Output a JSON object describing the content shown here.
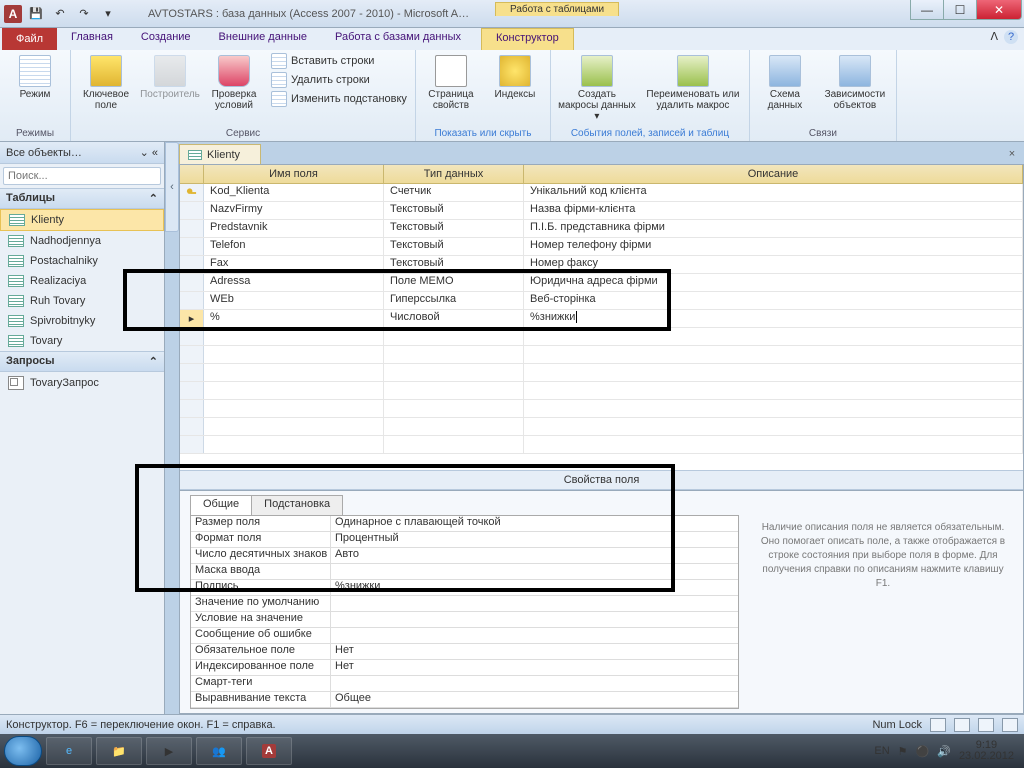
{
  "title": "AVTOSTARS : база данных (Access 2007 - 2010) -  Microsoft A…",
  "context_tab_group": "Работа с таблицами",
  "file_tab": "Файл",
  "tabs": [
    "Главная",
    "Создание",
    "Внешние данные",
    "Работа с базами данных"
  ],
  "context_tab": "Конструктор",
  "ribbon": {
    "g1": {
      "mode": "Режим",
      "label": "Режимы"
    },
    "g2": {
      "key": "Ключевое поле",
      "builder": "Построитель",
      "check": "Проверка условий",
      "insert": "Вставить строки",
      "delete": "Удалить строки",
      "modify": "Изменить подстановку",
      "label": "Сервис"
    },
    "g3": {
      "prop": "Страница свойств",
      "index": "Индексы",
      "label": "Показать или скрыть"
    },
    "g4": {
      "createmacro": "Создать макросы данных ▾",
      "rename": "Переименовать или удалить макрос",
      "label": "События полей, записей и таблиц"
    },
    "g5": {
      "schema": "Схема данных",
      "deps": "Зависимости объектов",
      "label": "Связи"
    }
  },
  "nav": {
    "header": "Все объекты…",
    "search_ph": "Поиск...",
    "tables_hdr": "Таблицы",
    "tables": [
      "Klienty",
      "Nadhodjennya",
      "Postachalniky",
      "Realizaciya",
      "Ruh Tovary",
      "Spivrobitnyky",
      "Tovary"
    ],
    "queries_hdr": "Запросы",
    "queries": [
      "TovaryЗапрос"
    ]
  },
  "doc_tab": "Klienty",
  "design_hdr": {
    "name": "Имя поля",
    "type": "Тип данных",
    "desc": "Описание"
  },
  "rows": [
    {
      "pk": true,
      "name": "Kod_Klienta",
      "type": "Счетчик",
      "desc": "Унікальний код клієнта"
    },
    {
      "name": "NazvFirmy",
      "type": "Текстовый",
      "desc": "Назва фірми-клієнта"
    },
    {
      "name": "Predstavnik",
      "type": "Текстовый",
      "desc": "П.І.Б. представника фірми"
    },
    {
      "name": "Telefon",
      "type": "Текстовый",
      "desc": "Номер телефону фірми"
    },
    {
      "name": "Fax",
      "type": "Текстовый",
      "desc": "Номер факсу"
    },
    {
      "name": "Adressa",
      "type": "Поле МЕМО",
      "desc": "Юридична адреса фірми"
    },
    {
      "name": "WEb",
      "type": "Гиперссылка",
      "desc": "Веб-сторінка"
    },
    {
      "name": "%",
      "type": "Числовой",
      "desc": "%знижки",
      "active": true
    }
  ],
  "props_header": "Свойства поля",
  "ptabs": {
    "general": "Общие",
    "lookup": "Подстановка"
  },
  "props": [
    {
      "l": "Размер поля",
      "v": "Одинарное с плавающей точкой"
    },
    {
      "l": "Формат поля",
      "v": "Процентный"
    },
    {
      "l": "Число десятичных знаков",
      "v": "Авто"
    },
    {
      "l": "Маска ввода",
      "v": ""
    },
    {
      "l": "Подпись",
      "v": "%знижки"
    },
    {
      "l": "Значение по умолчанию",
      "v": ""
    },
    {
      "l": "Условие на значение",
      "v": ""
    },
    {
      "l": "Сообщение об ошибке",
      "v": ""
    },
    {
      "l": "Обязательное поле",
      "v": "Нет"
    },
    {
      "l": "Индексированное поле",
      "v": "Нет"
    },
    {
      "l": "Смарт-теги",
      "v": ""
    },
    {
      "l": "Выравнивание текста",
      "v": "Общее"
    }
  ],
  "hint": "Наличие описания поля не является обязательным. Оно помогает описать поле, а также отображается в строке состояния при выборе поля в форме. Для получения справки по описаниям нажмите клавишу F1.",
  "status": "Конструктор.  F6 = переключение окон.  F1 = справка.",
  "numlock": "Num Lock",
  "lang": "EN",
  "time": "9:19",
  "date": "23.02.2012"
}
